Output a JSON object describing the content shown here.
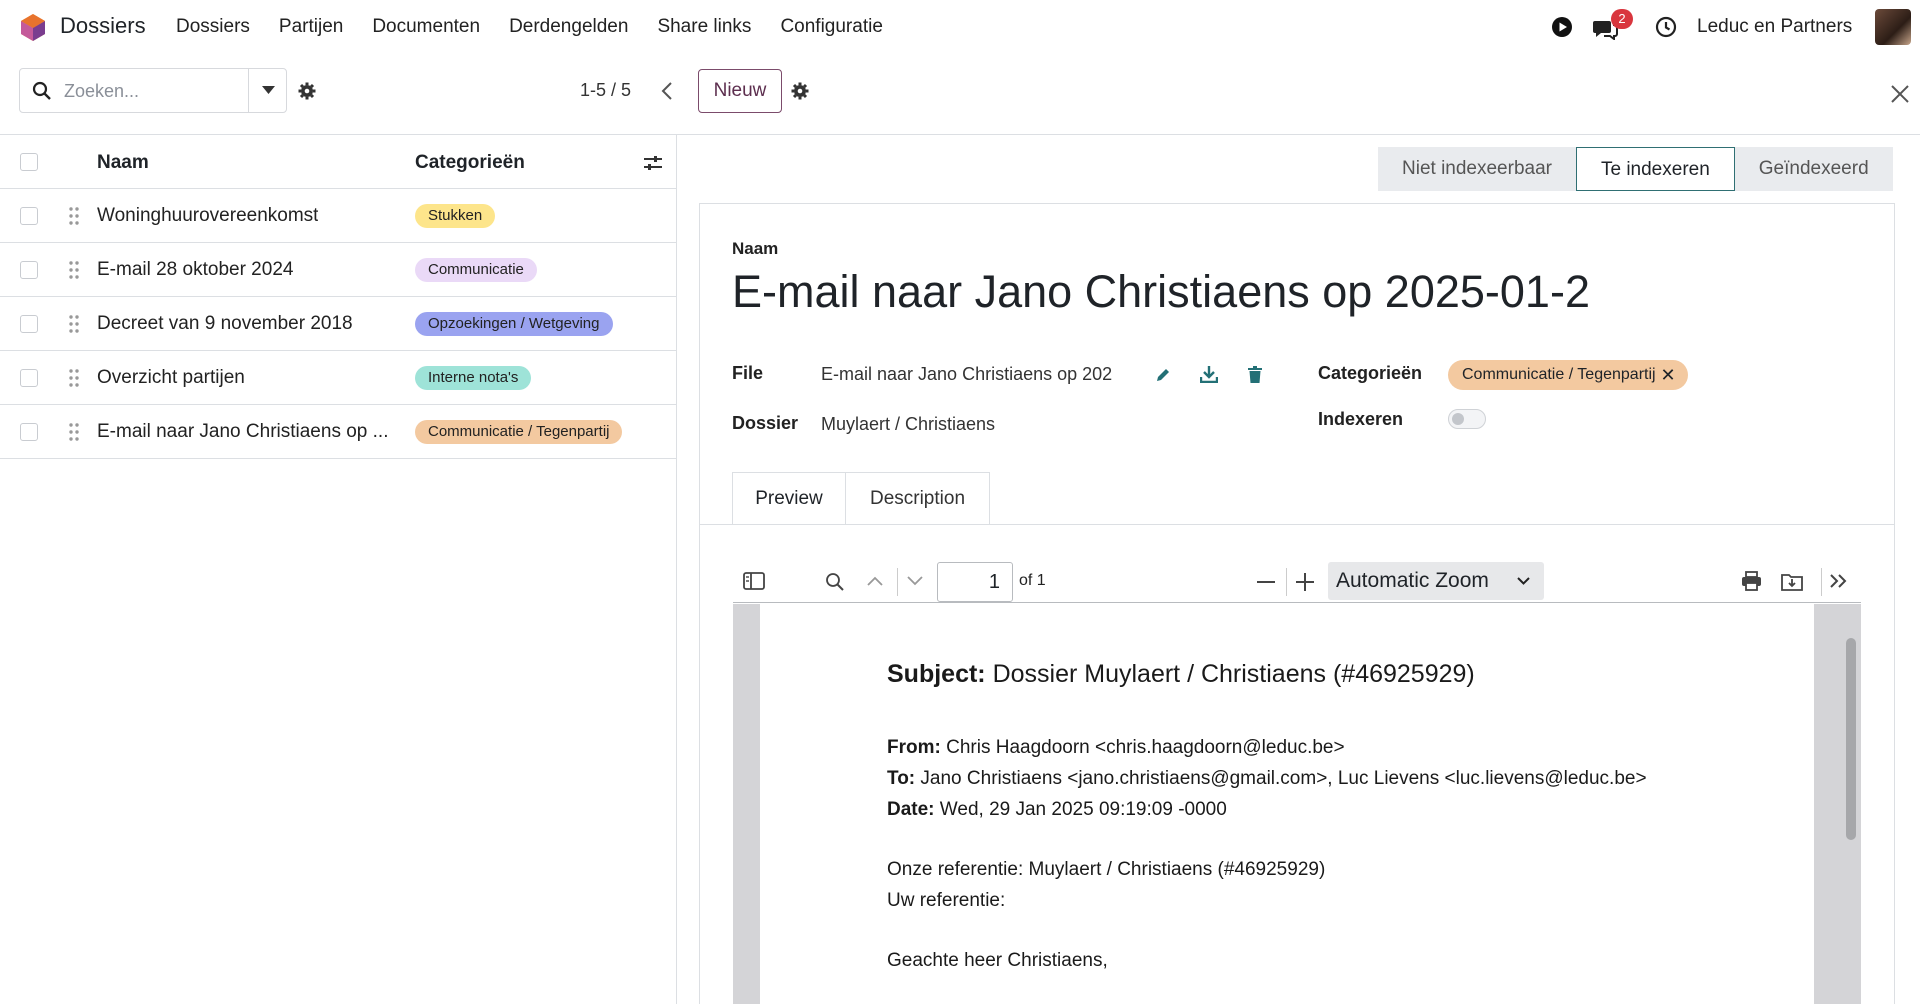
{
  "topbar": {
    "app_name": "Dossiers",
    "menu": [
      "Dossiers",
      "Partijen",
      "Documenten",
      "Derdengelden",
      "Share links",
      "Configuratie"
    ],
    "notification_count": "2",
    "company": "Leduc en Partners"
  },
  "control_panel": {
    "search_placeholder": "Zoeken...",
    "pager": "1-5 / 5",
    "new_label": "Nieuw"
  },
  "list": {
    "col_name": "Naam",
    "col_categories": "Categorieën",
    "rows": [
      {
        "name": "Woninghuurovereenkomst",
        "tag": "Stukken",
        "tag_color": "#fde58b"
      },
      {
        "name": "E-mail 28 oktober 2024",
        "tag": "Communicatie",
        "tag_color": "#ead9f7"
      },
      {
        "name": "Decreet van 9 november 2018",
        "tag": "Opzoekingen / Wetgeving",
        "tag_color": "#9aa3f0"
      },
      {
        "name": "Overzicht partijen",
        "tag": "Interne nota's",
        "tag_color": "#9ee3d8"
      },
      {
        "name": "E-mail naar Jano Christiaens op ...",
        "tag": "Communicatie / Tegenpartij",
        "tag_color": "#f3c9a0"
      }
    ]
  },
  "statusbar": [
    "Niet indexeerbaar",
    "Te indexeren",
    "Geïndexeerd"
  ],
  "record": {
    "name_label": "Naam",
    "name": "E-mail naar Jano Christiaens op 2025-01-2",
    "file_label": "File",
    "file_value": "E-mail naar Jano Christiaens op 202",
    "dossier_label": "Dossier",
    "dossier_value": "Muylaert / Christiaens",
    "categories_label": "Categorieën",
    "category_tag": "Communicatie / Tegenpartij",
    "index_label": "Indexeren",
    "index_on": false
  },
  "tabs": [
    "Preview",
    "Description"
  ],
  "pdf": {
    "page": "1",
    "of": "of 1",
    "zoom": "Automatic Zoom",
    "subject_label": "Subject:",
    "subject": "Dossier Muylaert / Christiaens (#46925929)",
    "from_label": "From:",
    "from": "Chris Haagdoorn <chris.haagdoorn@leduc.be>",
    "to_label": "To:",
    "to": "Jano Christiaens <jano.christiaens@gmail.com>, Luc Lievens <luc.lievens@leduc.be>",
    "date_label": "Date:",
    "date": "Wed, 29 Jan 2025 09:19:09 -0000",
    "ref_ours": "Onze referentie: Muylaert / Christiaens (#46925929)",
    "ref_yours": "Uw referentie:",
    "greeting": "Geachte heer Christiaens,"
  }
}
